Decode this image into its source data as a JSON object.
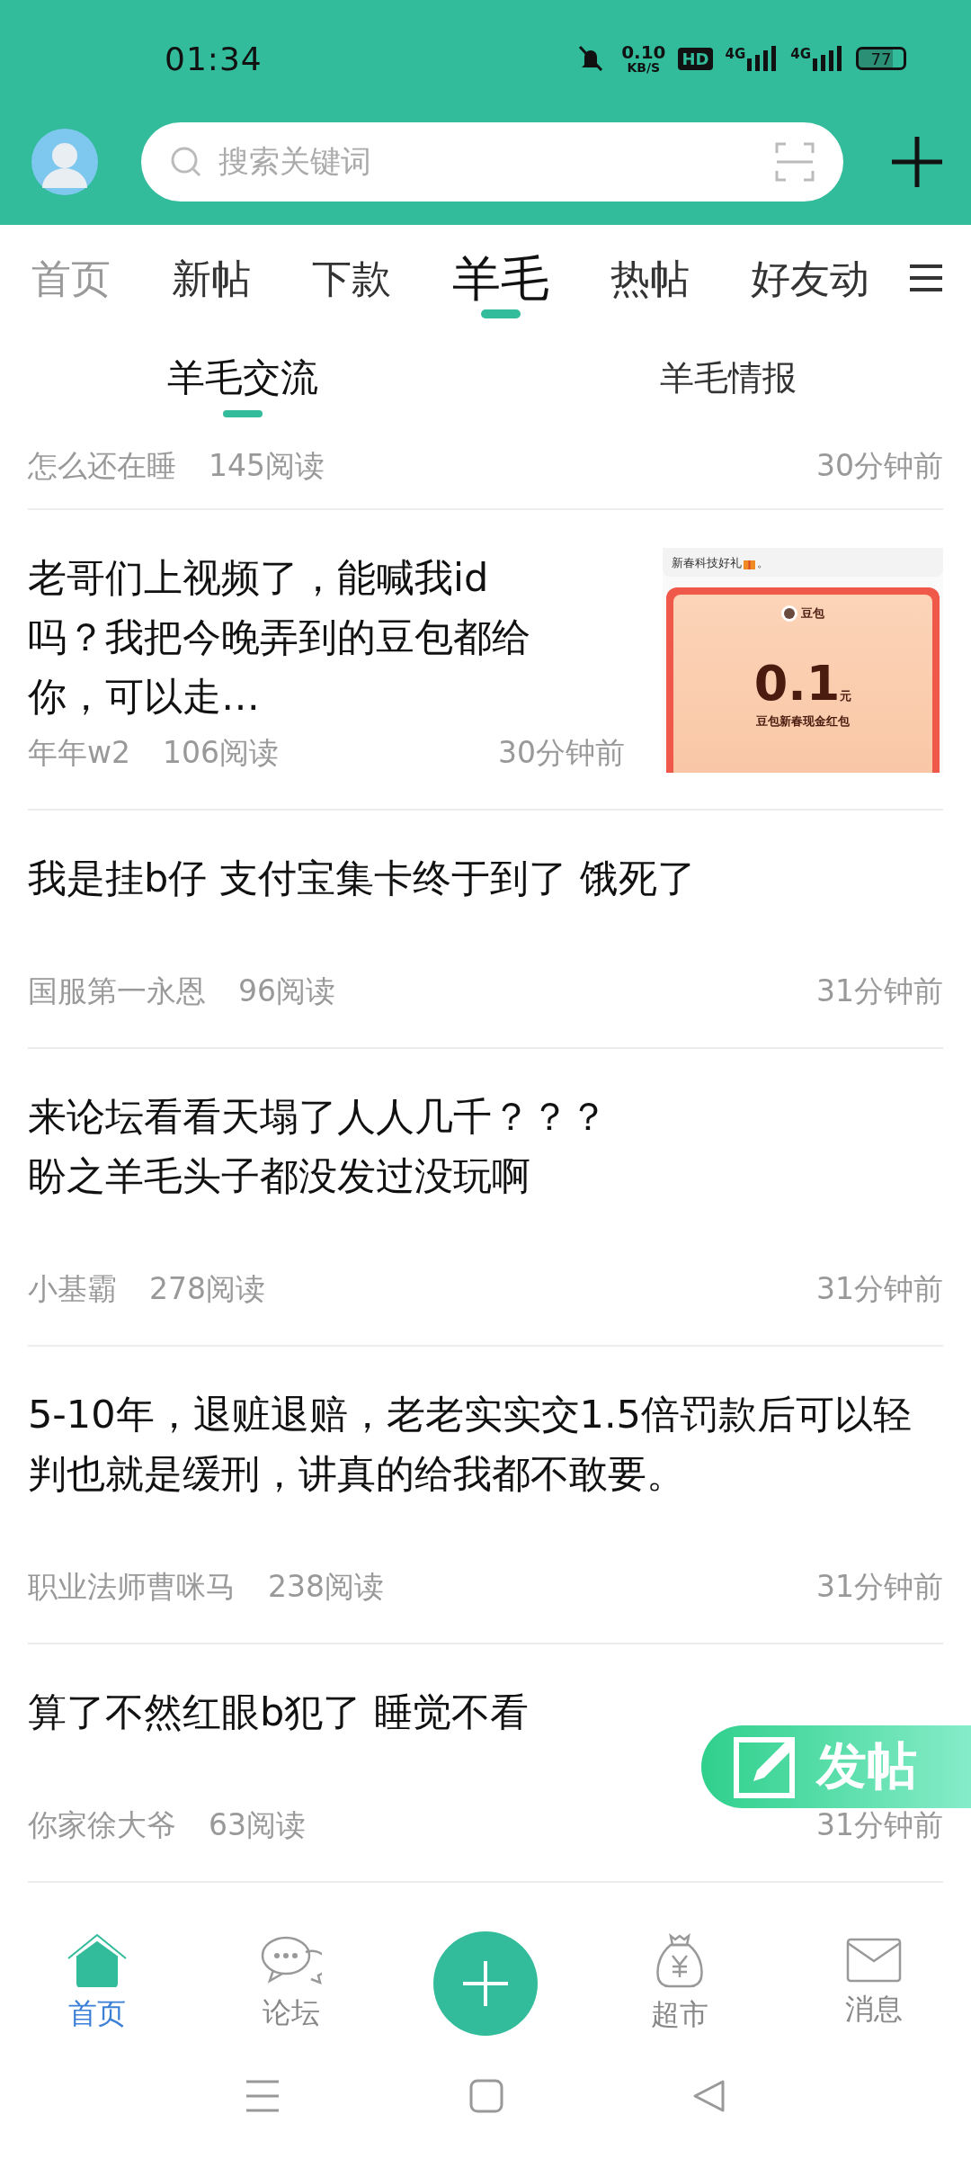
{
  "status_bar": {
    "time": "01:34",
    "net_speed": "0.10",
    "net_unit": "KB/S",
    "hd": "HD",
    "signals": [
      "4G",
      "4G"
    ],
    "battery": "77"
  },
  "header": {
    "search": {
      "placeholder": "搜索关键词"
    }
  },
  "tabs": [
    {
      "label": "首页",
      "selected": false
    },
    {
      "label": "新帖",
      "selected": false
    },
    {
      "label": "下款",
      "selected": false
    },
    {
      "label": "羊毛",
      "selected": true
    },
    {
      "label": "热帖",
      "selected": false
    },
    {
      "label": "好友动",
      "selected": false
    }
  ],
  "sub_tabs": [
    {
      "label": "羊毛交流",
      "selected": true
    },
    {
      "label": "羊毛情报",
      "selected": false
    }
  ],
  "posts": [
    {
      "author": "怎么还在睡",
      "reads": "145阅读",
      "time": "30分钟前"
    },
    {
      "title": "老哥们上视频了，能喊我id吗？我把今晚弄到的豆包都给你，可以走…",
      "author": "年年w2",
      "reads": "106阅读",
      "time": "30分钟前",
      "thumbnail": {
        "caption": "新春科技好礼",
        "caption_end": "。",
        "brand": "豆包",
        "amount": "0.1",
        "unit": "元",
        "label": "豆包新春现金红包"
      }
    },
    {
      "title": "我是挂b仔 支付宝集卡终于到了 饿死了",
      "author": "国服第一永恩",
      "reads": "96阅读",
      "time": "31分钟前"
    },
    {
      "title": "来论坛看看天塌了人人几千？？？",
      "title_line_2": "盼之羊毛头子都没发过没玩啊",
      "author": "小基霸",
      "reads": "278阅读",
      "time": "31分钟前"
    },
    {
      "title": "5-10年，退赃退赔，老老实实交1.5倍罚款后可以轻判也就是缓刑，讲真的给我都不敢要。",
      "author": "职业法师曹咪马",
      "reads": "238阅读",
      "time": "31分钟前"
    },
    {
      "title": "算了不然红眼b犯了 睡觉不看",
      "author": "你家徐大爷",
      "reads": "63阅读",
      "time": "31分钟前"
    }
  ],
  "float_button": {
    "label": "发帖"
  },
  "bottom_nav": [
    {
      "kind": "home",
      "label": "首页",
      "selected": true
    },
    {
      "kind": "forum",
      "label": "论坛",
      "selected": false
    },
    {
      "kind": "add",
      "selected": false
    },
    {
      "kind": "market",
      "label": "超市",
      "selected": false
    },
    {
      "kind": "messages",
      "label": "消息",
      "selected": false
    }
  ]
}
